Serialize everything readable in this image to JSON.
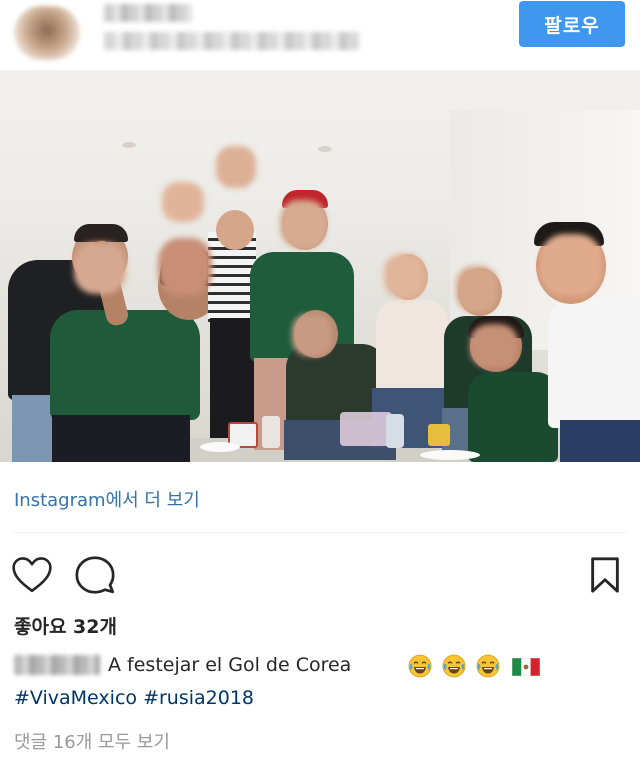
{
  "header": {
    "follow_label": "팔로우"
  },
  "more_link": "Instagram에서 더 보기",
  "likes": "좋아요 32개",
  "caption": {
    "text": "A festejar el Gol de Corea"
  },
  "hashtags": [
    "#VivaMexico",
    "#rusia2018"
  ],
  "comments_link": "댓글 16개 모두 보기",
  "icons": {
    "like": "heart-icon",
    "comment": "comment-icon",
    "save": "bookmark-icon",
    "emoji_laugh": "tears-of-joy-emoji",
    "flag": "mexico-flag-emoji"
  },
  "colors": {
    "follow_button": "#3f97f0",
    "link": "#3573a8",
    "hashtag": "#003569",
    "muted": "#999999"
  }
}
